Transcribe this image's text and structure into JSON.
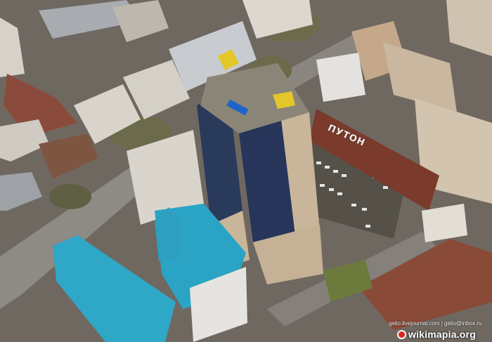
{
  "photo": {
    "roof_sign": "ПУТОН",
    "credit_line": "gelio.livejournal.com | gelio@inbox.ru",
    "watermark_brand": "wikimapia.org",
    "watermark_icon": "wikimapia-logo-icon",
    "colors": {
      "tower_beige": "#c9b69a",
      "tower_glass": "#2a3a5a",
      "teal_roof": "#2ba3c4",
      "red_roof": "#7a3a2c",
      "parking_lot": "#555149",
      "street": "#8e8a84",
      "trees": "#6b6a4a",
      "white_buildings": "#d8d4cc"
    }
  }
}
